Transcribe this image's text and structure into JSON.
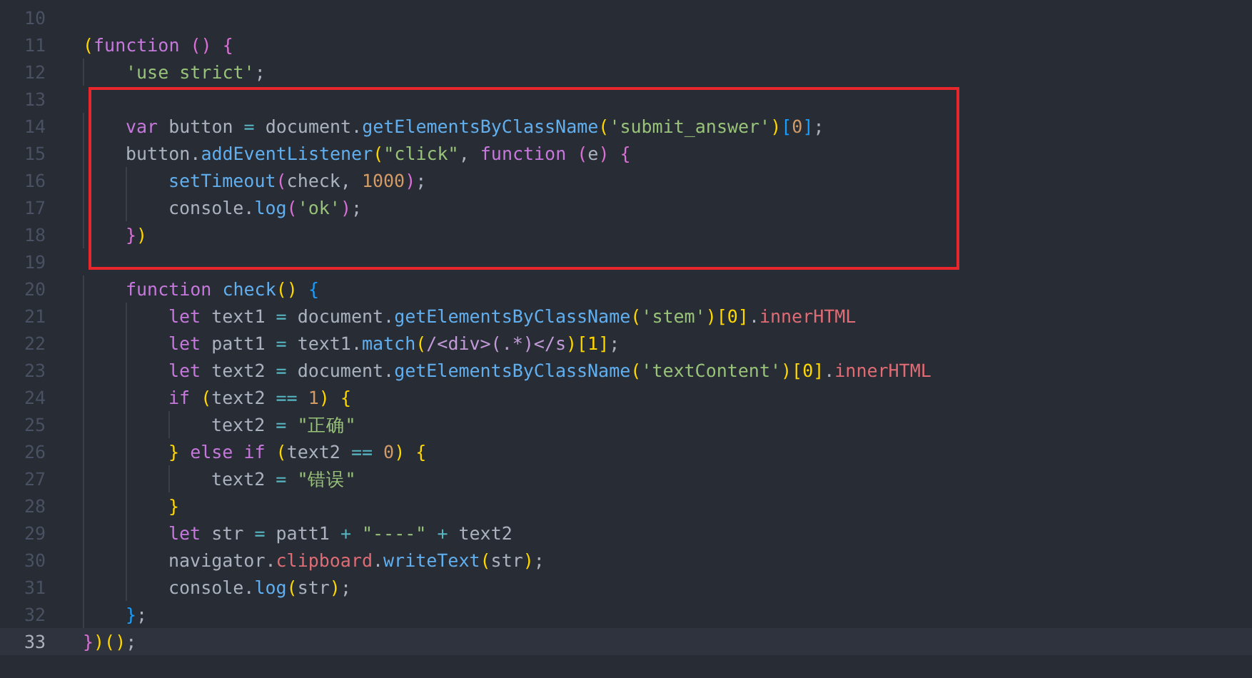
{
  "editor": {
    "blocks": [
      {
        "highlighted": false,
        "lines": [
          {
            "number": "10",
            "current": false
          },
          {
            "number": "11",
            "current": false,
            "tokens": [
              {
                "kind": "b1",
                "text": "("
              },
              {
                "kind": "kw",
                "text": "function "
              },
              {
                "kind": "b2",
                "text": "() "
              },
              {
                "kind": "b2",
                "text": "{"
              }
            ]
          },
          {
            "number": "12",
            "current": false,
            "tokens": [
              {
                "kind": "str",
                "text": "    'use strict'"
              },
              {
                "kind": "plain",
                "text": ";"
              }
            ]
          }
        ]
      },
      {
        "highlighted": true,
        "lines": [
          {
            "number": "13",
            "current": false
          },
          {
            "number": "14",
            "current": false,
            "tokens": [
              {
                "kind": "kw",
                "text": "    var"
              },
              {
                "kind": "plain",
                "text": " button "
              },
              {
                "kind": "op",
                "text": "="
              },
              {
                "kind": "plain",
                "text": " document."
              },
              {
                "kind": "fn",
                "text": "getElementsByClassName"
              },
              {
                "kind": "b1",
                "text": "("
              },
              {
                "kind": "str",
                "text": "'submit_answer'"
              },
              {
                "kind": "b1",
                "text": ")"
              },
              {
                "kind": "b3",
                "text": "["
              },
              {
                "kind": "num",
                "text": "0"
              },
              {
                "kind": "b3",
                "text": "]"
              },
              {
                "kind": "plain",
                "text": ";"
              }
            ]
          },
          {
            "number": "15",
            "current": false,
            "tokens": [
              {
                "kind": "plain",
                "text": "    button."
              },
              {
                "kind": "fn",
                "text": "addEventListener"
              },
              {
                "kind": "b1",
                "text": "("
              },
              {
                "kind": "str",
                "text": "\"click\""
              },
              {
                "kind": "plain",
                "text": ", "
              },
              {
                "kind": "kw",
                "text": "function "
              },
              {
                "kind": "b2",
                "text": "("
              },
              {
                "kind": "plain",
                "text": "e"
              },
              {
                "kind": "b2",
                "text": ") "
              },
              {
                "kind": "b2",
                "text": "{"
              }
            ]
          },
          {
            "number": "16",
            "current": false,
            "tokens": [
              {
                "kind": "fn",
                "text": "        setTimeout"
              },
              {
                "kind": "b2",
                "text": "("
              },
              {
                "kind": "plain",
                "text": "check, "
              },
              {
                "kind": "num",
                "text": "1000"
              },
              {
                "kind": "b2",
                "text": ")"
              },
              {
                "kind": "plain",
                "text": ";"
              }
            ]
          },
          {
            "number": "17",
            "current": false,
            "tokens": [
              {
                "kind": "plain",
                "text": "        console."
              },
              {
                "kind": "fn",
                "text": "log"
              },
              {
                "kind": "b2",
                "text": "("
              },
              {
                "kind": "str",
                "text": "'ok'"
              },
              {
                "kind": "b2",
                "text": ")"
              },
              {
                "kind": "plain",
                "text": ";"
              }
            ]
          },
          {
            "number": "18",
            "current": false,
            "tokens": [
              {
                "kind": "b2",
                "text": "    }"
              },
              {
                "kind": "b1",
                "text": ")"
              }
            ]
          },
          {
            "number": "19",
            "current": false
          }
        ]
      },
      {
        "highlighted": false,
        "lines": [
          {
            "number": "20",
            "current": false,
            "tokens": [
              {
                "kind": "kw",
                "text": "    function "
              },
              {
                "kind": "fn",
                "text": "check"
              },
              {
                "kind": "b1",
                "text": "() "
              },
              {
                "kind": "b3",
                "text": "{"
              }
            ]
          },
          {
            "number": "21",
            "current": false,
            "tokens": [
              {
                "kind": "kw",
                "text": "        let"
              },
              {
                "kind": "plain",
                "text": " text1 "
              },
              {
                "kind": "op",
                "text": "="
              },
              {
                "kind": "plain",
                "text": " document."
              },
              {
                "kind": "fn",
                "text": "getElementsByClassName"
              },
              {
                "kind": "b1",
                "text": "("
              },
              {
                "kind": "str",
                "text": "'stem'"
              },
              {
                "kind": "b1",
                "text": ")[0]"
              },
              {
                "kind": "plain",
                "text": "."
              },
              {
                "kind": "prop",
                "text": "innerHTML"
              }
            ]
          },
          {
            "number": "22",
            "current": false,
            "tokens": [
              {
                "kind": "kw",
                "text": "        let"
              },
              {
                "kind": "plain",
                "text": " patt1 "
              },
              {
                "kind": "op",
                "text": "="
              },
              {
                "kind": "plain",
                "text": " text1."
              },
              {
                "kind": "fn",
                "text": "match"
              },
              {
                "kind": "b1",
                "text": "("
              },
              {
                "kind": "regex",
                "text": "/<div>(.*)</s"
              },
              {
                "kind": "b1",
                "text": ")[1]"
              },
              {
                "kind": "plain",
                "text": ";"
              }
            ]
          },
          {
            "number": "23",
            "current": false,
            "tokens": [
              {
                "kind": "kw",
                "text": "        let"
              },
              {
                "kind": "plain",
                "text": " text2 "
              },
              {
                "kind": "op",
                "text": "="
              },
              {
                "kind": "plain",
                "text": " document."
              },
              {
                "kind": "fn",
                "text": "getElementsByClassName"
              },
              {
                "kind": "b1",
                "text": "("
              },
              {
                "kind": "str",
                "text": "'textContent'"
              },
              {
                "kind": "b1",
                "text": ")[0]"
              },
              {
                "kind": "plain",
                "text": "."
              },
              {
                "kind": "prop",
                "text": "innerHTML"
              }
            ]
          },
          {
            "number": "24",
            "current": false,
            "tokens": [
              {
                "kind": "kw",
                "text": "        if "
              },
              {
                "kind": "b1",
                "text": "("
              },
              {
                "kind": "plain",
                "text": "text2 "
              },
              {
                "kind": "op",
                "text": "=="
              },
              {
                "kind": "num",
                "text": " 1"
              },
              {
                "kind": "b1",
                "text": ") "
              },
              {
                "kind": "b1",
                "text": "{"
              }
            ]
          },
          {
            "number": "25",
            "current": false,
            "tokens": [
              {
                "kind": "plain",
                "text": "            text2 "
              },
              {
                "kind": "op",
                "text": "="
              },
              {
                "kind": "str",
                "text": " \"正确\""
              }
            ]
          },
          {
            "number": "26",
            "current": false,
            "tokens": [
              {
                "kind": "b1",
                "text": "        } "
              },
              {
                "kind": "kw",
                "text": "else if "
              },
              {
                "kind": "b1",
                "text": "("
              },
              {
                "kind": "plain",
                "text": "text2 "
              },
              {
                "kind": "op",
                "text": "=="
              },
              {
                "kind": "num",
                "text": " 0"
              },
              {
                "kind": "b1",
                "text": ") "
              },
              {
                "kind": "b1",
                "text": "{"
              }
            ]
          },
          {
            "number": "27",
            "current": false,
            "tokens": [
              {
                "kind": "plain",
                "text": "            text2 "
              },
              {
                "kind": "op",
                "text": "="
              },
              {
                "kind": "str",
                "text": " \"错误\""
              }
            ]
          },
          {
            "number": "28",
            "current": false,
            "tokens": [
              {
                "kind": "b1",
                "text": "        }"
              }
            ]
          },
          {
            "number": "29",
            "current": false,
            "tokens": [
              {
                "kind": "kw",
                "text": "        let"
              },
              {
                "kind": "plain",
                "text": " str "
              },
              {
                "kind": "op",
                "text": "="
              },
              {
                "kind": "plain",
                "text": " patt1 "
              },
              {
                "kind": "op",
                "text": "+"
              },
              {
                "kind": "str",
                "text": " \"----\" "
              },
              {
                "kind": "op",
                "text": "+"
              },
              {
                "kind": "plain",
                "text": " text2"
              }
            ]
          },
          {
            "number": "30",
            "current": false,
            "tokens": [
              {
                "kind": "plain",
                "text": "        navigator."
              },
              {
                "kind": "prop",
                "text": "clipboard"
              },
              {
                "kind": "plain",
                "text": "."
              },
              {
                "kind": "fn",
                "text": "writeText"
              },
              {
                "kind": "b1",
                "text": "("
              },
              {
                "kind": "plain",
                "text": "str"
              },
              {
                "kind": "b1",
                "text": ")"
              },
              {
                "kind": "plain",
                "text": ";"
              }
            ]
          },
          {
            "number": "31",
            "current": false,
            "tokens": [
              {
                "kind": "plain",
                "text": "        console."
              },
              {
                "kind": "fn",
                "text": "log"
              },
              {
                "kind": "b1",
                "text": "("
              },
              {
                "kind": "plain",
                "text": "str"
              },
              {
                "kind": "b1",
                "text": ")"
              },
              {
                "kind": "plain",
                "text": ";"
              }
            ]
          },
          {
            "number": "32",
            "current": false,
            "tokens": [
              {
                "kind": "b3",
                "text": "    }"
              },
              {
                "kind": "plain",
                "text": ";"
              }
            ]
          },
          {
            "number": "33",
            "current": true,
            "tokens": [
              {
                "kind": "b2",
                "text": "}"
              },
              {
                "kind": "b1",
                "text": ")()"
              },
              {
                "kind": "plain",
                "text": ";"
              }
            ]
          }
        ]
      }
    ]
  }
}
